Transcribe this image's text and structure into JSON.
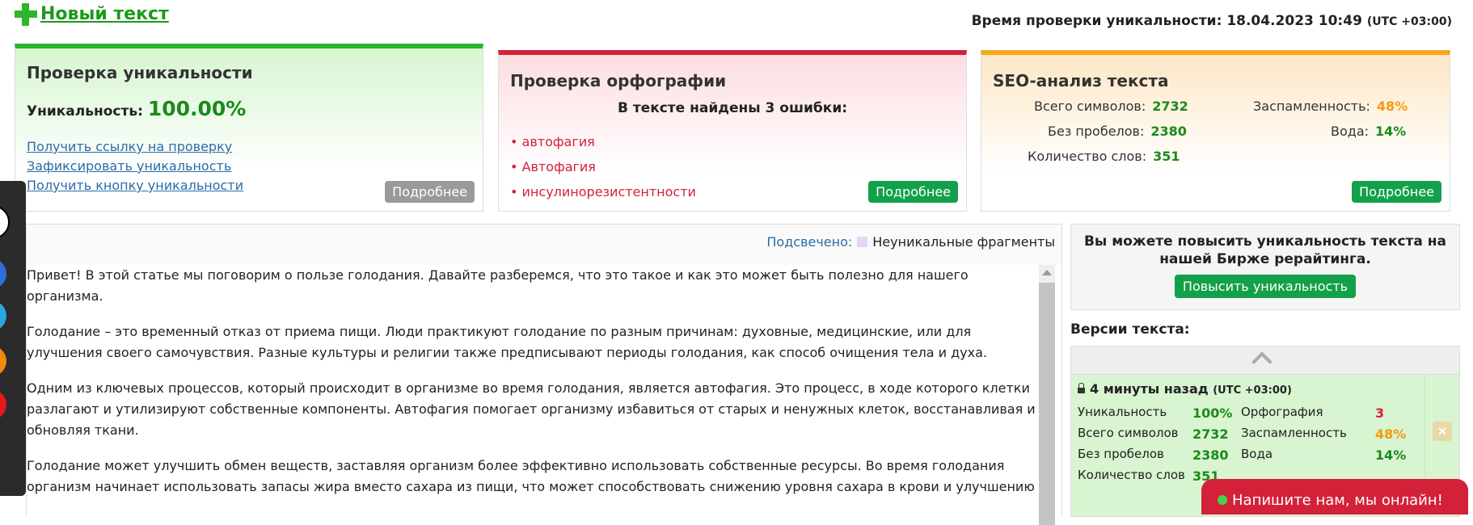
{
  "header": {
    "new_text_label": "Новый текст",
    "check_time_label": "Время проверки уникальности: 18.04.2023 10:49",
    "check_time_tz": "(UTC +03:00)"
  },
  "uniqueness_card": {
    "title": "Проверка уникальности",
    "uniq_label": "Уникальность:",
    "uniq_value": "100.00%",
    "links": [
      "Получить ссылку на проверку",
      "Зафиксировать уникальность",
      "Получить кнопку уникальности"
    ],
    "more_label": "Подробнее"
  },
  "spelling_card": {
    "title": "Проверка орфографии",
    "found_label": "В тексте найдены 3 ошибки:",
    "errors": [
      "автофагия",
      "Автофагия",
      "инсулинорезистентности"
    ],
    "more_label": "Подробнее"
  },
  "seo_card": {
    "title": "SEO-анализ текста",
    "total_chars_label": "Всего символов:",
    "total_chars": "2732",
    "no_spaces_label": "Без пробелов:",
    "no_spaces": "2380",
    "words_label": "Количество слов:",
    "words": "351",
    "spam_label": "Заспамленность:",
    "spam": "48%",
    "water_label": "Вода:",
    "water": "14%",
    "more_label": "Подробнее"
  },
  "text_panel": {
    "highlight_label": "Подсвечено:",
    "highlight_desc": "Неуникальные фрагменты",
    "paragraphs": [
      "Привет! В этой статье мы поговорим о пользе голодания. Давайте разберемся, что это такое и как это может быть полезно для нашего организма.",
      "Голодание – это временный отказ от приема пищи. Люди практикуют голодание по разным причинам: духовные, медицинские, или для улучшения своего самочувствия. Разные культуры и религии также предписывают периоды голодания, как способ очищения тела и духа.",
      "Одним из ключевых процессов, который происходит в организме во время голодания, является автофагия. Это процесс, в ходе которого клетки разлагают и утилизируют собственные компоненты. Автофагия помогает организму избавиться от старых и ненужных клеток, восстанавливая и обновляя ткани.",
      "Голодание может улучшить обмен веществ, заставляя организм более эффективно использовать собственные ресурсы. Во время голодания организм начинает использовать запасы жира вместо сахара из пищи, что может способствовать снижению уровня сахара в крови и улучшению"
    ]
  },
  "promo": {
    "text": "Вы можете повысить уникальность текста на нашей Бирже рерайтинга.",
    "button": "Повысить уникальность"
  },
  "versions": {
    "title": "Версии текста:",
    "time": "4 минуты назад",
    "tz": "(UTC +03:00)",
    "uniq_label": "Уникальность",
    "uniq": "100%",
    "spell_label": "Орфография",
    "spell": "3",
    "chars_label": "Всего символов",
    "chars": "2732",
    "spam_label": "Заспамленность",
    "spam": "48%",
    "nospace_label": "Без пробелов",
    "nospace": "2380",
    "water_label": "Вода",
    "water": "14%",
    "words_label": "Количество слов",
    "words": "351"
  },
  "chat": {
    "label": "Напишите нам, мы онлайн!"
  },
  "colors": {
    "green": "#2db52d",
    "red": "#d4213a",
    "orange": "#f5a81c",
    "button_green": "#13a04a"
  }
}
